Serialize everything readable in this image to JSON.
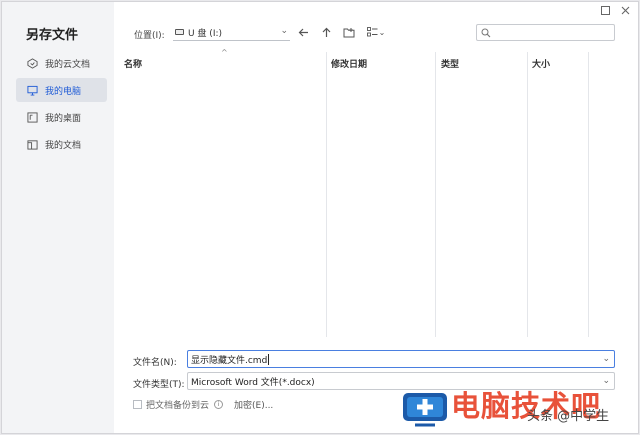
{
  "dialog": {
    "title": "另存文件"
  },
  "sidebar": {
    "items": [
      {
        "label": "我的云文档",
        "icon": "cloud-doc-icon",
        "active": false
      },
      {
        "label": "我的电脑",
        "icon": "computer-icon",
        "active": true
      },
      {
        "label": "我的桌面",
        "icon": "desktop-icon",
        "active": false
      },
      {
        "label": "我的文档",
        "icon": "documents-icon",
        "active": false
      }
    ]
  },
  "toolbar": {
    "location_label": "位置(I):",
    "location_value": "U 盘 (I:)"
  },
  "file_list": {
    "columns": [
      "名称",
      "修改日期",
      "类型",
      "大小"
    ],
    "rows": []
  },
  "form": {
    "filename_label": "文件名(N):",
    "filename_value": "显示隐藏文件.cmd",
    "filetype_label": "文件类型(T):",
    "filetype_value": "Microsoft Word 文件(*.docx)",
    "backup_label": "把文档备份到云",
    "encrypt_label": "加密(E)..."
  },
  "watermark": {
    "text": "电脑技术吧",
    "sub": "头条 @中学生"
  },
  "colors": {
    "accent": "#1f5bd6",
    "sidebar_bg": "#f3f4f6",
    "active_item_bg": "#dfe2e8",
    "watermark_red": "#e8523a"
  }
}
